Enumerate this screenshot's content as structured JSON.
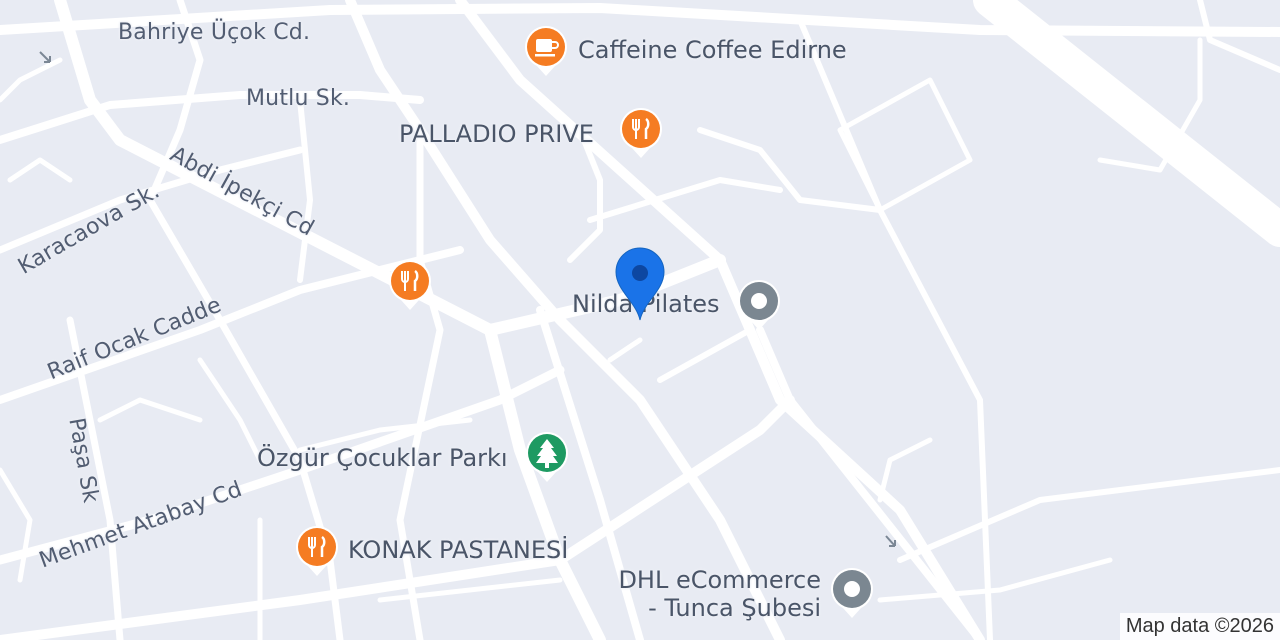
{
  "streets": [
    {
      "id": "bahriye",
      "name": "Bahriye Üçok Cd."
    },
    {
      "id": "mutlu",
      "name": "Mutlu Sk."
    },
    {
      "id": "abdi",
      "name": "Abdi İpekçi Cd"
    },
    {
      "id": "karacaova",
      "name": "Karacaova Sk."
    },
    {
      "id": "raif",
      "name": "Raif Ocak Cadde"
    },
    {
      "id": "pasa",
      "name": "Paşa Sk"
    },
    {
      "id": "mehmet",
      "name": "Mehmet Atabay Cd"
    }
  ],
  "pois": [
    {
      "id": "caffeine",
      "name": "Caffeine Coffee Edirne",
      "category": "cafe",
      "icon": "coffee-cup-icon",
      "color": "#f57c22"
    },
    {
      "id": "palladio",
      "name": "PALLADIO PRIVE",
      "category": "restaurant",
      "icon": "fork-knife-icon",
      "color": "#f57c22"
    },
    {
      "id": "unnamed-restaurant",
      "name": "",
      "category": "restaurant",
      "icon": "fork-knife-icon",
      "color": "#f57c22"
    },
    {
      "id": "nilda",
      "name": "Nilda Pilates",
      "category": "generic",
      "icon": "circle-pin-icon",
      "color": "#7b8791"
    },
    {
      "id": "ozgur",
      "name": "Özgür Çocuklar Parkı",
      "category": "park",
      "icon": "tree-icon",
      "color": "#1e9a62"
    },
    {
      "id": "konak",
      "name": "KONAK PASTANESİ",
      "category": "restaurant",
      "icon": "fork-knife-icon",
      "color": "#f57c22"
    },
    {
      "id": "dhl",
      "name_line1": "DHL eCommerce",
      "name_line2": "- Tunca Şubesi",
      "category": "generic",
      "icon": "circle-pin-icon",
      "color": "#7b8791"
    }
  ],
  "selected_location": {
    "icon": "location-pin-icon",
    "color": "#1a73e8"
  },
  "attribution": "Map data ©2026"
}
